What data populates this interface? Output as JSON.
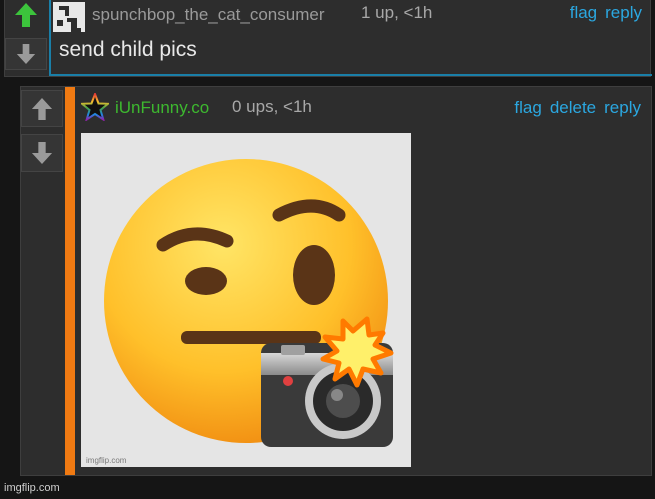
{
  "parent_comment": {
    "username": "spunchbop_the_cat_consumer",
    "meta": "1 up, <1h",
    "actions": [
      "flag",
      "reply"
    ],
    "text": "send child pics",
    "upvoted": true
  },
  "reply_comment": {
    "username": "iUnFunny.co",
    "meta": "0 ups, <1h",
    "actions": [
      "flag",
      "delete",
      "reply"
    ],
    "image_watermark": "imgflip.com"
  },
  "footer_watermark": "imgflip.com",
  "colors": {
    "username_parent": "#9a9a9a",
    "username_reply": "#3db82f",
    "link": "#2ba7e0",
    "upvote_active": "#3cc43c",
    "reply_bar": "#f07a12",
    "focus_border": "#1a7fa8"
  }
}
